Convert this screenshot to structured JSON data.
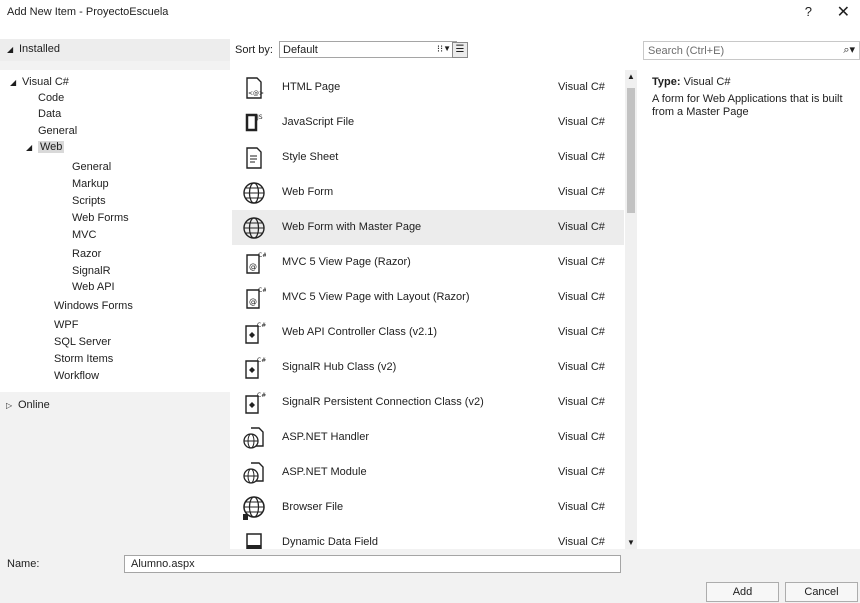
{
  "window": {
    "title": "Add New Item - ProyectoEscuela",
    "help_label": "?",
    "close_label": "✕"
  },
  "left": {
    "header_label": "Installed",
    "tree": [
      {
        "label": "Visual C#",
        "expanded": true
      },
      {
        "label": "Code"
      },
      {
        "label": "Data"
      },
      {
        "label": "General"
      },
      {
        "label": "Web",
        "expanded": true,
        "selected": true
      },
      {
        "label": "General"
      },
      {
        "label": "Markup"
      },
      {
        "label": "Scripts"
      },
      {
        "label": "Web Forms"
      },
      {
        "label": "MVC"
      },
      {
        "label": "Razor"
      },
      {
        "label": "SignalR"
      },
      {
        "label": "Web API"
      },
      {
        "label": "Windows Forms"
      },
      {
        "label": "WPF"
      },
      {
        "label": "SQL Server"
      },
      {
        "label": "Storm Items"
      },
      {
        "label": "Workflow"
      }
    ],
    "online_label": "Online"
  },
  "sort": {
    "label": "Sort by:",
    "value": "Default"
  },
  "search": {
    "placeholder": "Search (Ctrl+E)"
  },
  "templates": [
    {
      "name": "HTML Page",
      "lang": "Visual C#",
      "icon": "html-page-icon"
    },
    {
      "name": "JavaScript File",
      "lang": "Visual C#",
      "icon": "javascript-file-icon"
    },
    {
      "name": "Style Sheet",
      "lang": "Visual C#",
      "icon": "style-sheet-icon"
    },
    {
      "name": "Web Form",
      "lang": "Visual C#",
      "icon": "globe-icon"
    },
    {
      "name": "Web Form with Master Page",
      "lang": "Visual C#",
      "icon": "globe-icon",
      "selected": true
    },
    {
      "name": "MVC 5 View Page (Razor)",
      "lang": "Visual C#",
      "icon": "razor-view-icon"
    },
    {
      "name": "MVC 5 View Page with Layout (Razor)",
      "lang": "Visual C#",
      "icon": "razor-view-icon"
    },
    {
      "name": "Web API Controller Class (v2.1)",
      "lang": "Visual C#",
      "icon": "csharp-class-icon"
    },
    {
      "name": "SignalR Hub Class (v2)",
      "lang": "Visual C#",
      "icon": "csharp-class-icon"
    },
    {
      "name": "SignalR Persistent Connection Class (v2)",
      "lang": "Visual C#",
      "icon": "csharp-class-icon"
    },
    {
      "name": "ASP.NET Handler",
      "lang": "Visual C#",
      "icon": "globe-page-icon"
    },
    {
      "name": "ASP.NET Module",
      "lang": "Visual C#",
      "icon": "globe-page-icon"
    },
    {
      "name": "Browser File",
      "lang": "Visual C#",
      "icon": "browser-file-icon"
    },
    {
      "name": "Dynamic Data Field",
      "lang": "Visual C#",
      "icon": "data-field-icon"
    }
  ],
  "details": {
    "type_label": "Type:",
    "type_value": "Visual C#",
    "description": "A form for Web Applications that is built from a Master Page"
  },
  "bottom": {
    "name_label": "Name:",
    "name_value": "Alumno.aspx",
    "add_label": "Add",
    "cancel_label": "Cancel"
  }
}
